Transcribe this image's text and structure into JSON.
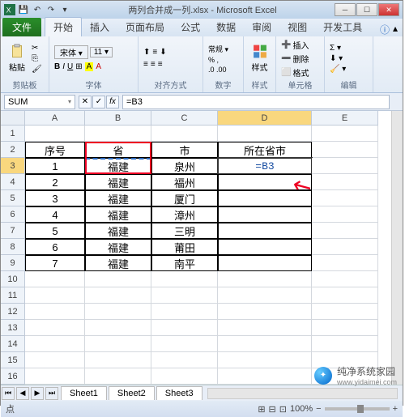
{
  "titlebar": {
    "filename": "两列合并成一列.xlsx",
    "app": "Microsoft Excel"
  },
  "ribbon": {
    "tabs": [
      "文件",
      "开始",
      "插入",
      "页面布局",
      "公式",
      "数据",
      "审阅",
      "视图",
      "开发工具"
    ],
    "groups": {
      "clipboard": {
        "label": "剪贴板",
        "paste": "粘贴"
      },
      "font": {
        "label": "字体"
      },
      "alignment": {
        "label": "对齐方式"
      },
      "number": {
        "label": "数字"
      },
      "styles": {
        "label": "样式",
        "button": "样式"
      },
      "cells": {
        "label": "单元格",
        "insert": "插入",
        "delete": "删除",
        "format": "格式"
      },
      "editing": {
        "label": "编辑"
      }
    }
  },
  "formula_bar": {
    "name_box": "SUM",
    "formula": "=B3"
  },
  "grid": {
    "columns": [
      "A",
      "B",
      "C",
      "D",
      "E"
    ],
    "active_cell": "D3",
    "marching_cell": "B3",
    "headers_row": 2,
    "headers": {
      "A": "序号",
      "B": "省",
      "C": "市",
      "D": "所在省市"
    },
    "data": [
      {
        "row": 3,
        "A": "1",
        "B": "福建",
        "C": "泉州",
        "D": "=B3"
      },
      {
        "row": 4,
        "A": "2",
        "B": "福建",
        "C": "福州",
        "D": ""
      },
      {
        "row": 5,
        "A": "3",
        "B": "福建",
        "C": "厦门",
        "D": ""
      },
      {
        "row": 6,
        "A": "4",
        "B": "福建",
        "C": "漳州",
        "D": ""
      },
      {
        "row": 7,
        "A": "5",
        "B": "福建",
        "C": "三明",
        "D": ""
      },
      {
        "row": 8,
        "A": "6",
        "B": "福建",
        "C": "莆田",
        "D": ""
      },
      {
        "row": 9,
        "A": "7",
        "B": "福建",
        "C": "南平",
        "D": ""
      }
    ],
    "visible_row_count": 17
  },
  "sheets": {
    "tabs": [
      "Sheet1",
      "Sheet2",
      "Sheet3"
    ]
  },
  "statusbar": {
    "mode": "点",
    "zoom": "100%"
  },
  "watermark": {
    "line1": "纯净系统家园",
    "line2": "www.yidaimei.com"
  },
  "colors": {
    "accent": "#2a6ac2",
    "annotation": "#e02020",
    "col_highlight": "#f9d77e"
  }
}
